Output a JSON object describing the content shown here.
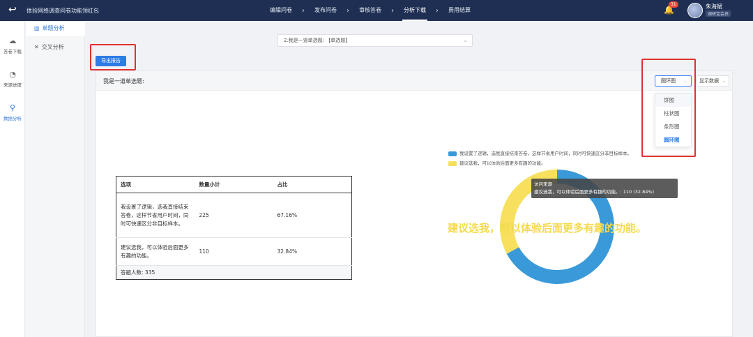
{
  "header": {
    "back_icon": "back-arrow-icon",
    "title": "体验网络调查问卷功能领红包",
    "steps": [
      {
        "label": "编辑问卷"
      },
      {
        "label": "发布问卷"
      },
      {
        "label": "审核答卷"
      },
      {
        "label": "分析下载"
      },
      {
        "label": "费用结算"
      }
    ],
    "active_step": "分析下载",
    "notification_count": "31",
    "user_name": "朱海斌",
    "user_sub": "调研宝会员"
  },
  "leftnav": {
    "items": [
      {
        "label": "答卷下载",
        "icon": "cloud-download-icon"
      },
      {
        "label": "来源进度",
        "icon": "pie-progress-icon"
      },
      {
        "label": "数据分析",
        "icon": "magnifier-icon"
      }
    ],
    "active": "数据分析"
  },
  "subnav": {
    "items": [
      {
        "label": "单题分析",
        "icon": "bar-chart-icon"
      },
      {
        "label": "交叉分析",
        "icon": "cross-icon"
      }
    ],
    "active": "单题分析"
  },
  "question_select": {
    "value": "2.我是一道单选题: 【单选题】"
  },
  "export_button": {
    "label": "导出报告"
  },
  "panel": {
    "title": "我是一道单选题:",
    "chart_type_select": {
      "value": "圆环图"
    },
    "chart_type_options": [
      "饼图",
      "柱状图",
      "条形图",
      "圆环图"
    ],
    "show_data_select": {
      "value": "显示数据"
    }
  },
  "table": {
    "headers": [
      "选项",
      "数量小计",
      "占比"
    ],
    "rows": [
      {
        "option": "我设置了逻辑，选我直接结束答卷，这样节省用户时间，同时可快速区分非目标样本。",
        "count": "225",
        "percent": "67.16%"
      },
      {
        "option": "建议选我，可以体验后面更多有趣的功能。",
        "count": "110",
        "percent": "32.84%"
      }
    ],
    "footer_label": "答题人数:",
    "footer_value": "335"
  },
  "chart_data": {
    "type": "pie",
    "donut": true,
    "categories": [
      "我设置了逻辑，选我直接结束答卷，这样节省用户时间，同时可快速区分非目标样本。",
      "建议选我，可以体验后面更多有趣的功能。"
    ],
    "values": [
      225,
      110
    ],
    "colors": [
      "#3a9ad9",
      "#f6e05e"
    ],
    "legend_placement": "top",
    "tooltip": {
      "title": "访问来源",
      "text": "建议选我，可以体验后面更多有趣的功能。: 110 (32.84%)"
    },
    "highlight_label": "建议选我，可以体验后面更多有趣的功能。"
  },
  "colors": {
    "accent": "#2d7be5",
    "topbar": "#1e2f53",
    "highlight_box": "#e03131"
  }
}
